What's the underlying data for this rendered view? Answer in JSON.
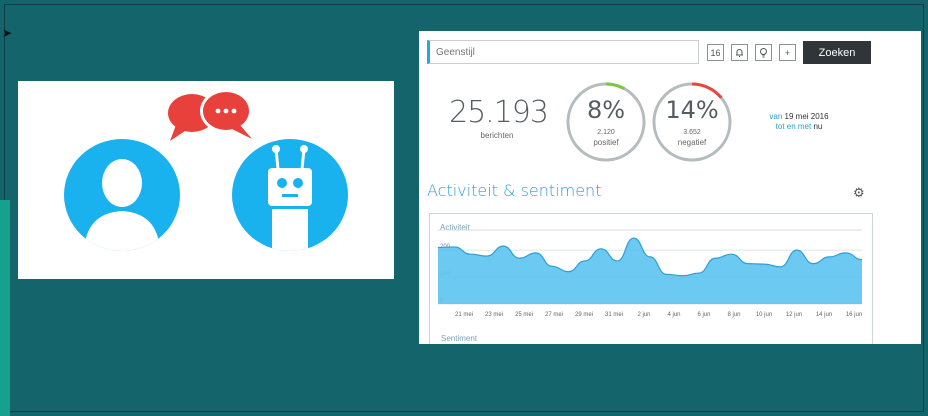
{
  "search": {
    "placeholder": "Geenstijl",
    "button_label": "Zoeken"
  },
  "toolbar": {
    "calendar_day": "16",
    "add_symbol": "+"
  },
  "stats": {
    "messages": {
      "value": "25.193",
      "label": "berichten"
    },
    "positive": {
      "percent": "8%",
      "count": "2.120",
      "label": "positief",
      "fraction": 0.08,
      "color": "#7cc63a"
    },
    "negative": {
      "percent": "14%",
      "count": "3.652",
      "label": "negatief",
      "fraction": 0.14,
      "color": "#e8473a"
    }
  },
  "date_range": {
    "van": "van",
    "from": "19 mei 2016",
    "tot_en_met": "tot en met",
    "to": "nu"
  },
  "section": {
    "title": "Activiteit & sentiment"
  },
  "chart_data": {
    "type": "area",
    "title": "Activiteit",
    "categories": [
      "21 mei",
      "23 mei",
      "25 mei",
      "27 mei",
      "29 mei",
      "31 mei",
      "2 jun",
      "4 jun",
      "6 jun",
      "8 jun",
      "10 jun",
      "12 jun",
      "14 jun",
      "16 jun"
    ],
    "y_ticks": [
      "200",
      "100",
      "0"
    ],
    "ylim": [
      0,
      260
    ],
    "values": [
      210,
      212,
      185,
      178,
      215,
      170,
      190,
      140,
      120,
      160,
      205,
      160,
      245,
      175,
      110,
      105,
      115,
      170,
      185,
      150,
      148,
      138,
      200,
      150,
      175,
      190,
      165
    ],
    "color": "#5cc3ef"
  },
  "sentiment_label": "Sentiment",
  "colors": {
    "background": "#14646c",
    "avatar": "#19b2ef",
    "bubble": "#e8413c",
    "accent": "#2aa0cf"
  },
  "icons": [
    "user-icon",
    "robot-icon",
    "chat-bubble-icon",
    "calendar-icon",
    "bell-icon",
    "lightbulb-icon",
    "plus-icon",
    "gear-icon"
  ]
}
